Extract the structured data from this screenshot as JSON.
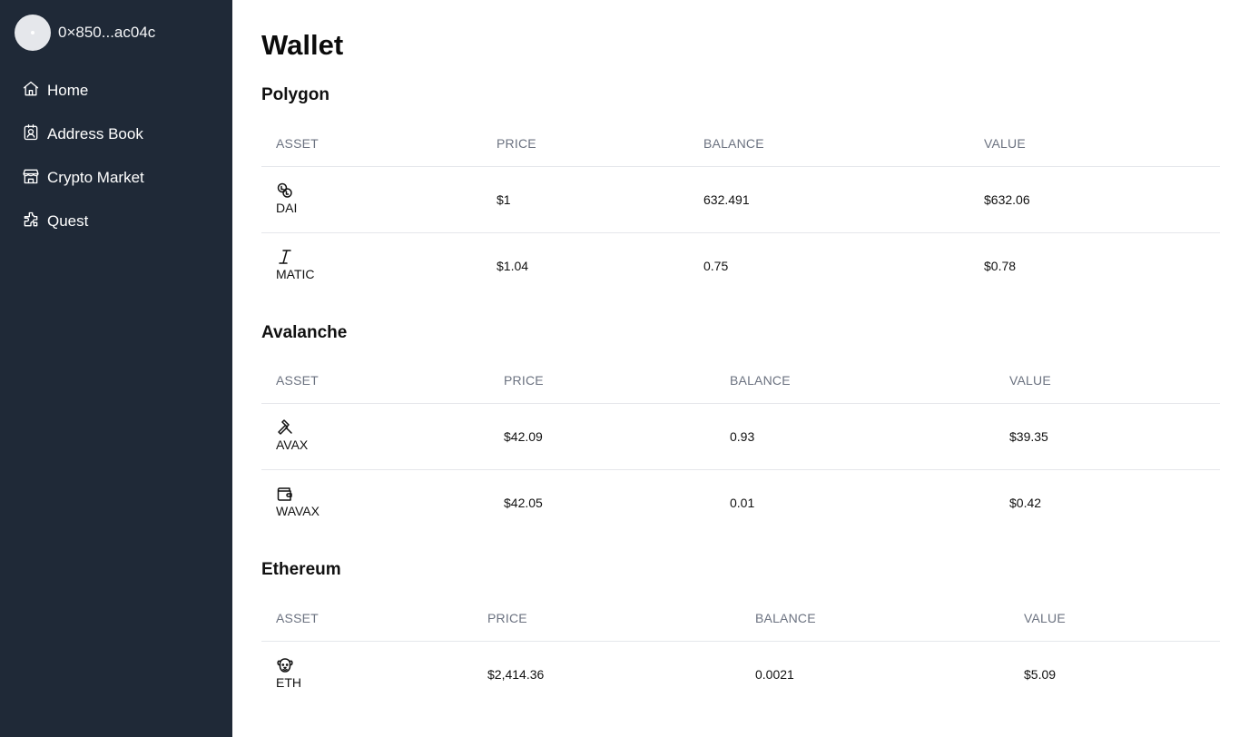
{
  "sidebar": {
    "account": {
      "label": "0×850...ac04c"
    },
    "items": [
      {
        "label": "Home",
        "icon": "home-icon"
      },
      {
        "label": "Address Book",
        "icon": "contact-card-icon"
      },
      {
        "label": "Crypto Market",
        "icon": "storefront-icon"
      },
      {
        "label": "Quest",
        "icon": "puzzle-icon"
      }
    ]
  },
  "main": {
    "title": "Wallet",
    "columns": {
      "asset": "ASSET",
      "price": "PRICE",
      "balance": "BALANCE",
      "value": "VALUE"
    },
    "sections": [
      {
        "name": "Polygon",
        "rows": [
          {
            "symbol": "DAI",
            "icon": "coins-icon",
            "price": "$1",
            "balance": "632.491",
            "value": "$632.06"
          },
          {
            "symbol": "MATIC",
            "icon": "italic-icon",
            "price": "$1.04",
            "balance": "0.75",
            "value": "$0.78"
          }
        ]
      },
      {
        "name": "Avalanche",
        "rows": [
          {
            "symbol": "AVAX",
            "icon": "gavel-icon",
            "price": "$42.09",
            "balance": "0.93",
            "value": "$39.35"
          },
          {
            "symbol": "WAVAX",
            "icon": "wallet-icon",
            "price": "$42.05",
            "balance": "0.01",
            "value": "$0.42"
          }
        ]
      },
      {
        "name": "Ethereum",
        "rows": [
          {
            "symbol": "ETH",
            "icon": "dog-face-icon",
            "price": "$2,414.36",
            "balance": "0.0021",
            "value": "$5.09"
          }
        ]
      }
    ]
  },
  "colors": {
    "sidebar_bg": "#1f2937",
    "header_text": "#6b7280",
    "divider": "#e5e7eb"
  }
}
